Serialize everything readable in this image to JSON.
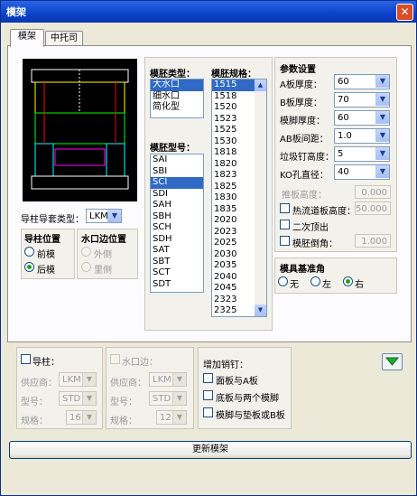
{
  "window": {
    "title": "模架",
    "close_glyph": "✕"
  },
  "tabs": [
    {
      "label": "模架"
    },
    {
      "label": "中托司"
    }
  ],
  "guide_sleeve": {
    "label": "导柱导套类型：",
    "value": "LKM"
  },
  "guide_pos": {
    "title": "导柱位置",
    "options": [
      "前模",
      "后模"
    ],
    "selected": "后模"
  },
  "gate_pos": {
    "title": "水口边位置",
    "options": [
      "外侧",
      "里侧"
    ]
  },
  "mold_type": {
    "label": "模胚类型：",
    "items": [
      "大水口",
      "细水口",
      "简化型"
    ],
    "selected": "大水口"
  },
  "mold_model": {
    "label": "模胚型号：",
    "items": [
      "SAI",
      "SBI",
      "SCI",
      "SDI",
      "SAH",
      "SBH",
      "SCH",
      "SDH",
      "SAT",
      "SBT",
      "SCT",
      "SDT"
    ],
    "selected": "SCI"
  },
  "mold_spec": {
    "label": "模胚规格：",
    "items": [
      "1515",
      "1518",
      "1520",
      "1523",
      "1525",
      "1530",
      "1818",
      "1820",
      "1823",
      "1825",
      "1830",
      "1835",
      "2020",
      "2023",
      "2025",
      "2030",
      "2035",
      "2040",
      "2045",
      "2323",
      "2325"
    ],
    "selected": "1515"
  },
  "params": {
    "title": "参数设置",
    "rows": [
      {
        "label": "A板厚度：",
        "value": "60"
      },
      {
        "label": "B板厚度：",
        "value": "70"
      },
      {
        "label": "模脚厚度：",
        "value": "60"
      },
      {
        "label": "AB板间距：",
        "value": "1.0"
      },
      {
        "label": "垃圾钉高度：",
        "value": "5"
      },
      {
        "label": "KO孔直径：",
        "value": "40"
      }
    ],
    "push_plate": {
      "label": "推板高度：",
      "value": "0.000"
    },
    "hot_runner": {
      "label": "热流道板高度：",
      "value": "50.000"
    },
    "second_eject": {
      "label": "二次顶出"
    },
    "chamfer": {
      "label": "模胚倒角：",
      "value": "1.000"
    }
  },
  "datum": {
    "title": "模具基准角",
    "options": [
      "无",
      "左",
      "右"
    ],
    "selected": "右"
  },
  "guide_pin": {
    "label": "导柱：",
    "supplier_label": "供应商：",
    "supplier": "LKM",
    "model_label": "型号：",
    "model": "STD",
    "spec_label": "规格：",
    "spec": "16"
  },
  "gate_side": {
    "label": "水口边：",
    "supplier_label": "供应商：",
    "supplier": "LKM",
    "model_label": "型号：",
    "model": "STD",
    "spec_label": "规格：",
    "spec": "12"
  },
  "dowel": {
    "title": "增加销钉：",
    "options": [
      "面板与A板",
      "底板与两个模脚",
      "模脚与垫板或B板"
    ]
  },
  "update_button": "更新模架",
  "colors": {
    "title_bar": "#0a42c8",
    "selection": "#316ac5",
    "accent_green": "#21a121"
  }
}
